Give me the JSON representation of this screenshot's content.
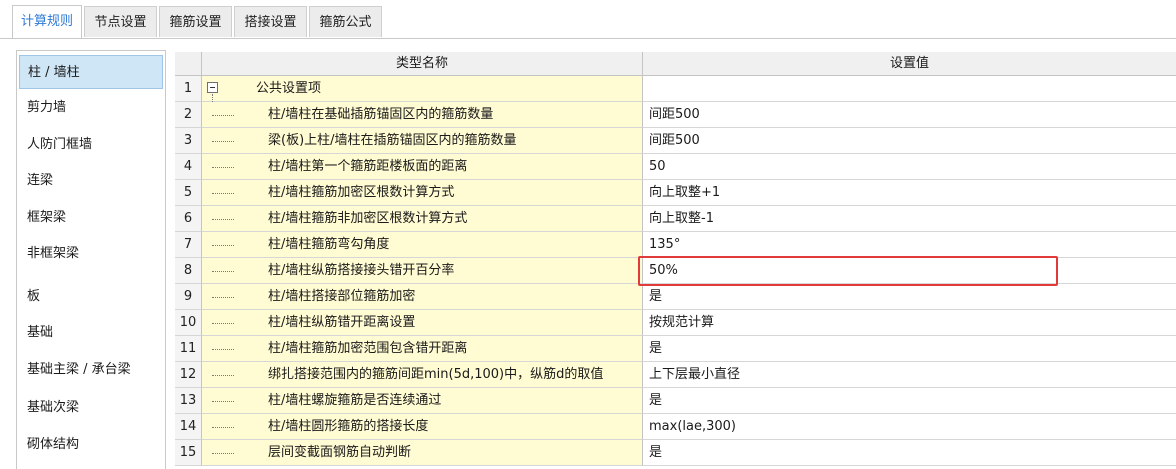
{
  "tabs": [
    {
      "label": "计算规则",
      "active": true
    },
    {
      "label": "节点设置",
      "active": false
    },
    {
      "label": "箍筋设置",
      "active": false
    },
    {
      "label": "搭接设置",
      "active": false
    },
    {
      "label": "箍筋公式",
      "active": false
    }
  ],
  "sidebar": {
    "items": [
      {
        "label": "柱 / 墙柱",
        "active": true
      },
      {
        "label": "剪力墙"
      },
      {
        "label": "人防门框墙"
      },
      {
        "label": "连梁"
      },
      {
        "label": "框架梁"
      },
      {
        "label": "非框架梁"
      },
      {
        "label": "板"
      },
      {
        "label": "基础"
      },
      {
        "label": "基础主梁 / 承台梁"
      },
      {
        "label": "基础次梁"
      },
      {
        "label": "砌体结构"
      }
    ]
  },
  "table": {
    "columns": [
      "类型名称",
      "设置值"
    ],
    "group": {
      "num": "1",
      "name": "公共设置项",
      "value": ""
    },
    "rows": [
      {
        "num": "2",
        "name": "柱/墙柱在基础插筋锚固区内的箍筋数量",
        "value": "间距500"
      },
      {
        "num": "3",
        "name": "梁(板)上柱/墙柱在插筋锚固区内的箍筋数量",
        "value": "间距500"
      },
      {
        "num": "4",
        "name": "柱/墙柱第一个箍筋距楼板面的距离",
        "value": "50"
      },
      {
        "num": "5",
        "name": "柱/墙柱箍筋加密区根数计算方式",
        "value": "向上取整+1"
      },
      {
        "num": "6",
        "name": "柱/墙柱箍筋非加密区根数计算方式",
        "value": "向上取整-1"
      },
      {
        "num": "7",
        "name": "柱/墙柱箍筋弯勾角度",
        "value": "135°"
      },
      {
        "num": "8",
        "name": "柱/墙柱纵筋搭接接头错开百分率",
        "value": "50%",
        "highlighted": true
      },
      {
        "num": "9",
        "name": "柱/墙柱搭接部位箍筋加密",
        "value": "是"
      },
      {
        "num": "10",
        "name": "柱/墙柱纵筋错开距离设置",
        "value": "按规范计算"
      },
      {
        "num": "11",
        "name": "柱/墙柱箍筋加密范围包含错开距离",
        "value": "是"
      },
      {
        "num": "12",
        "name": "绑扎搭接范围内的箍筋间距min(5d,100)中，纵筋d的取值",
        "value": "上下层最小直径"
      },
      {
        "num": "13",
        "name": "柱/墙柱螺旋箍筋是否连续通过",
        "value": "是"
      },
      {
        "num": "14",
        "name": "柱/墙柱圆形箍筋的搭接长度",
        "value": "max(lae,300)"
      },
      {
        "num": "15",
        "name": "层间变截面钢筋自动判断",
        "value": "是"
      }
    ]
  },
  "colors": {
    "accent": "#2f7bd6",
    "name_bg": "#fffbd2",
    "highlight_border": "#e03a3a",
    "sidebar_active": "#cfe6f7"
  }
}
